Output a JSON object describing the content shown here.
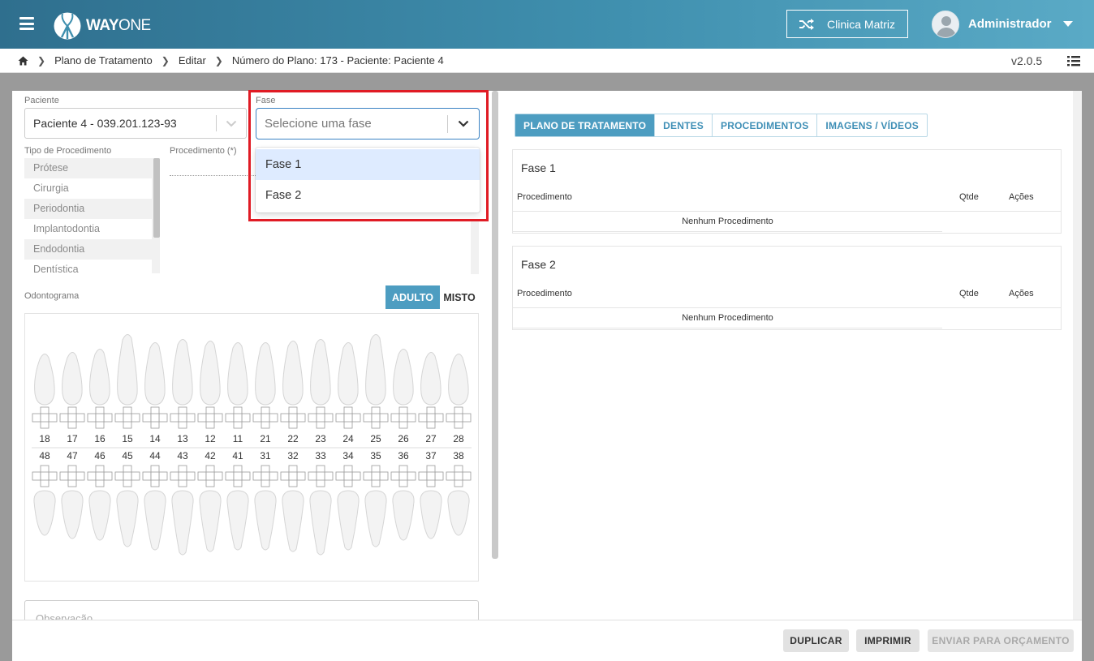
{
  "app": {
    "logo_text_bold": "WAY",
    "logo_text_light": "ONE"
  },
  "header": {
    "clinic": "Clinica Matriz",
    "user": "Administrador"
  },
  "breadcrumb": {
    "items": [
      "Plano de Tratamento",
      "Editar",
      "Número do Plano: 173 - Paciente: Paciente 4"
    ],
    "version": "v2.0.5"
  },
  "form": {
    "paciente_label": "Paciente",
    "paciente_value": "Paciente 4 - 039.201.123-93",
    "fase_label": "Fase",
    "fase_placeholder": "Selecione uma fase",
    "fase_options": [
      "Fase 1",
      "Fase 2"
    ],
    "tipo_label": "Tipo de Procedimento",
    "tipos": [
      "Prótese",
      "Cirurgia",
      "Periodontia",
      "Implantodontia",
      "Endodontia",
      "Dentística"
    ],
    "procedimento_label": "Procedimento (*)",
    "odontograma_label": "Odontograma",
    "adulto": "ADULTO",
    "misto": "MISTO",
    "observacao_placeholder": "Observação"
  },
  "teeth": {
    "upper": [
      "18",
      "17",
      "16",
      "15",
      "14",
      "13",
      "12",
      "11",
      "21",
      "22",
      "23",
      "24",
      "25",
      "26",
      "27",
      "28"
    ],
    "lower": [
      "48",
      "47",
      "46",
      "45",
      "44",
      "43",
      "42",
      "41",
      "31",
      "32",
      "33",
      "34",
      "35",
      "36",
      "37",
      "38"
    ]
  },
  "tabs": [
    "PLANO DE TRATAMENTO",
    "DENTES",
    "PROCEDIMENTOS",
    "IMAGENS / VÍDEOS"
  ],
  "phases": [
    {
      "title": "Fase 1",
      "col_proc": "Procedimento",
      "col_qtde": "Qtde",
      "col_acoes": "Ações",
      "empty": "Nenhum Procedimento"
    },
    {
      "title": "Fase 2",
      "col_proc": "Procedimento",
      "col_qtde": "Qtde",
      "col_acoes": "Ações",
      "empty": "Nenhum Procedimento"
    }
  ],
  "footer": {
    "duplicar": "DUPLICAR",
    "imprimir": "IMPRIMIR",
    "enviar": "ENVIAR PARA ORÇAMENTO"
  },
  "colors": {
    "accent": "#4d9dc1",
    "header_start": "#2f6f8e",
    "highlight": "#e01b24"
  }
}
